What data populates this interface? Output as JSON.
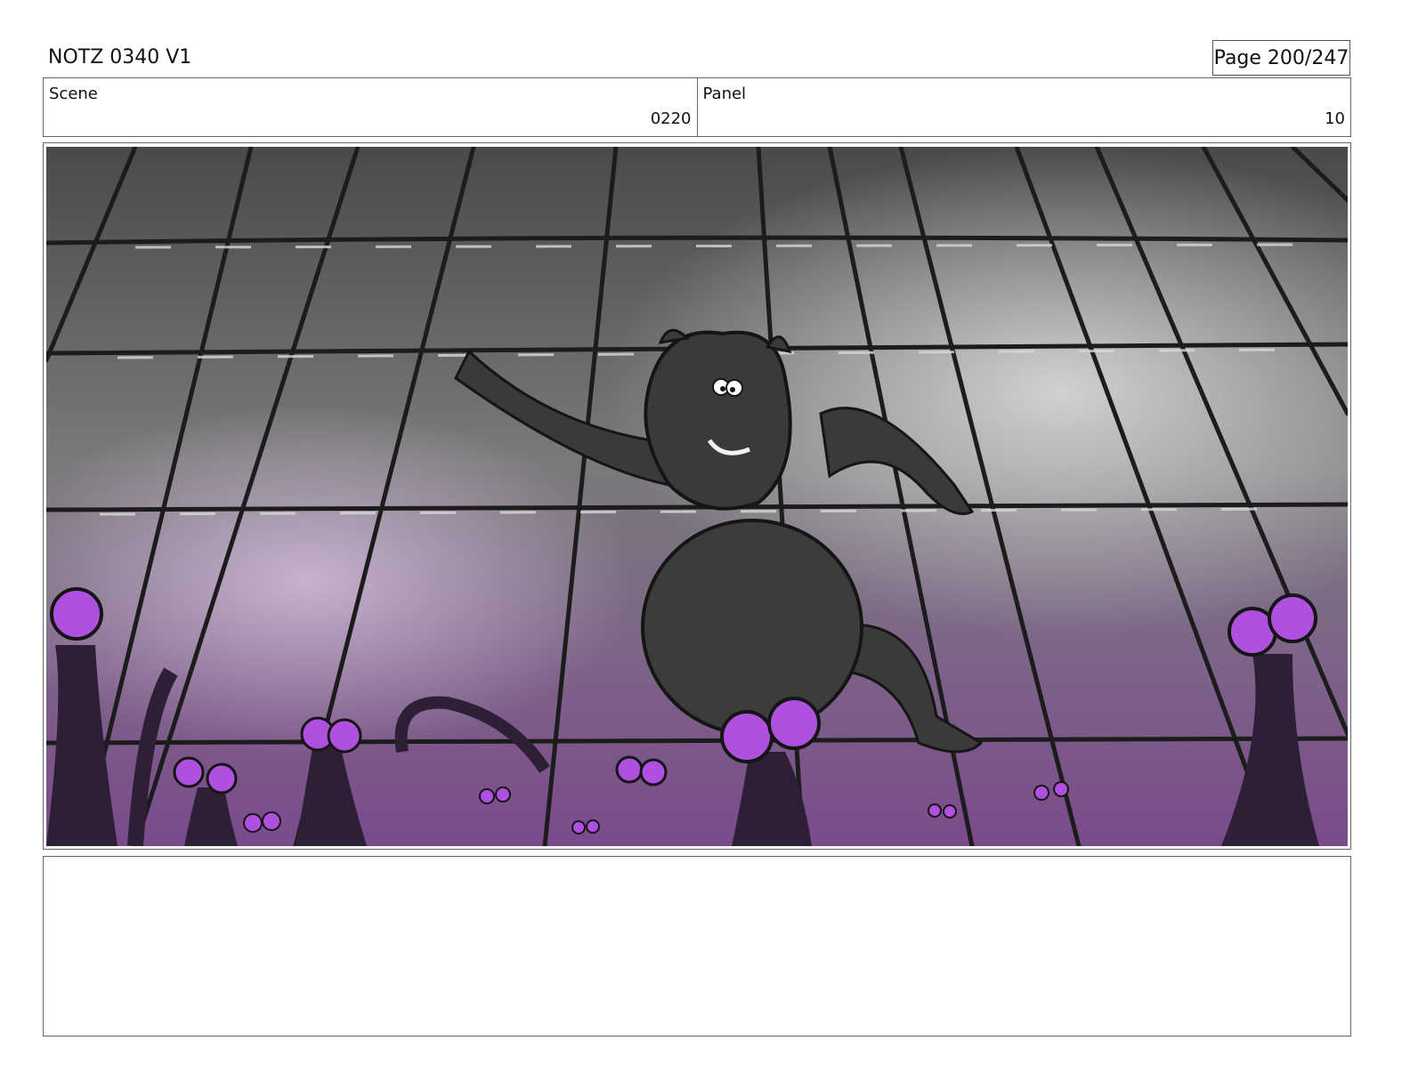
{
  "header": {
    "title": "NOTZ 0340 V1",
    "page": "Page 200/247"
  },
  "info": {
    "scene_label": "Scene",
    "scene_value": "0220",
    "panel_label": "Panel",
    "panel_value": "10"
  },
  "colors": {
    "creature_glow": "#b050e0",
    "floor_purple": "#7a4a8c",
    "grid_line": "#1c1c1c"
  },
  "notes": ""
}
